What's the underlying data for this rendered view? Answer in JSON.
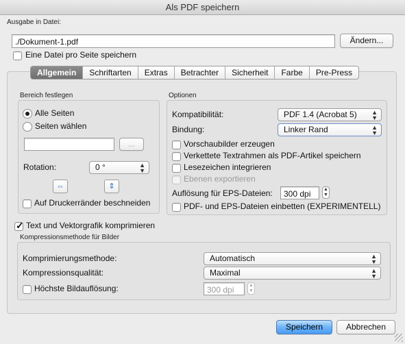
{
  "window": {
    "title": "Als PDF speichern"
  },
  "output": {
    "section_label": "Ausgabe in Datei:",
    "file_path": "./Dokument-1.pdf",
    "change_button": "Ändern...",
    "one_file_per_page": "Eine Datei pro Seite speichern"
  },
  "tabs": [
    "Allgemein",
    "Schriftarten",
    "Extras",
    "Betrachter",
    "Sicherheit",
    "Farbe",
    "Pre-Press"
  ],
  "active_tab": "Allgemein",
  "range": {
    "group_label": "Bereich festlegen",
    "all_pages": "Alle Seiten",
    "choose_pages": "Seiten wählen",
    "pages_value": "",
    "dots_button": "...",
    "rotation_label": "Rotation:",
    "rotation_value": "0 °",
    "fit_printer_margins": "Auf Druckerränder beschneiden"
  },
  "options": {
    "group_label": "Optionen",
    "compat_label": "Kompatibilität:",
    "compat_value": "PDF 1.4 (Acrobat 5)",
    "binding_label": "Bindung:",
    "binding_value": "Linker Rand",
    "thumbnails": "Vorschaubilder erzeugen",
    "linked_frames": "Verkettete Textrahmen als PDF-Artikel speichern",
    "bookmarks": "Lesezeichen integrieren",
    "export_layers": "Ebenen exportieren",
    "eps_resolution_label": "Auflösung für EPS-Dateien:",
    "eps_resolution_value": "300 dpi",
    "embed_pdf_eps": "PDF- und EPS-Dateien einbetten (EXPERIMENTELL)"
  },
  "compression": {
    "compress_checkbox": "Text und Vektorgrafik komprimieren",
    "group_label": "Kompressionsmethode für Bilder",
    "method_label": "Komprimierungsmethode:",
    "method_value": "Automatisch",
    "quality_label": "Kompressionsqualität:",
    "quality_value": "Maximal",
    "max_res_label": "Höchste Bildauflösung:",
    "max_res_value": "300 dpi"
  },
  "footer": {
    "save_button": "Speichern",
    "cancel_button": "Abbrechen"
  },
  "colors": {
    "primary_button": "#6db3f7",
    "active_tab": "#7a7a7a",
    "window_bg": "#ececec"
  }
}
